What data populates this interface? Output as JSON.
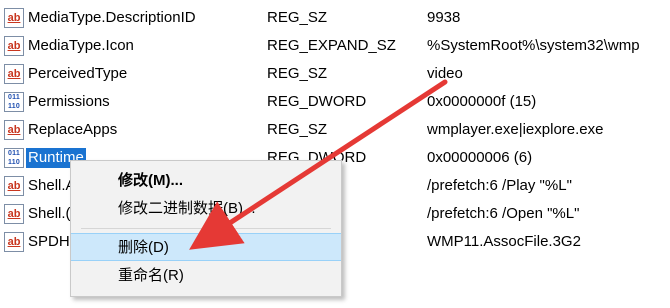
{
  "rows": [
    {
      "icon": "ab",
      "name": "MediaType.DescriptionID",
      "type": "REG_SZ",
      "data": "9938"
    },
    {
      "icon": "ab",
      "name": "MediaType.Icon",
      "type": "REG_EXPAND_SZ",
      "data": "%SystemRoot%\\system32\\wmp"
    },
    {
      "icon": "ab",
      "name": "PerceivedType",
      "type": "REG_SZ",
      "data": "video"
    },
    {
      "icon": "011 110",
      "name": "Permissions",
      "type": "REG_DWORD",
      "data": "0x0000000f (15)"
    },
    {
      "icon": "ab",
      "name": "ReplaceApps",
      "type": "REG_SZ",
      "data": "wmplayer.exe|iexplore.exe"
    },
    {
      "icon": "011 110",
      "name": "Runtime",
      "type": "REG_DWORD",
      "data": "0x00000006 (6)"
    },
    {
      "icon": "ab",
      "name": "Shell.A",
      "type": "",
      "data": "/prefetch:6 /Play \"%L\""
    },
    {
      "icon": "ab",
      "name": "Shell.(",
      "type": "",
      "data": "/prefetch:6 /Open \"%L\""
    },
    {
      "icon": "ab",
      "name": "SPDH",
      "type": "",
      "data": "WMP11.AssocFile.3G2"
    }
  ],
  "context_menu": {
    "modify": "修改(M)...",
    "modify_binary": "修改二进制数据(B)...",
    "delete": "删除(D)",
    "rename": "重命名(R)"
  },
  "colors": {
    "selection": "#1a73d1",
    "arrow": "#e53935",
    "menu_hover": "#cde8fb"
  }
}
